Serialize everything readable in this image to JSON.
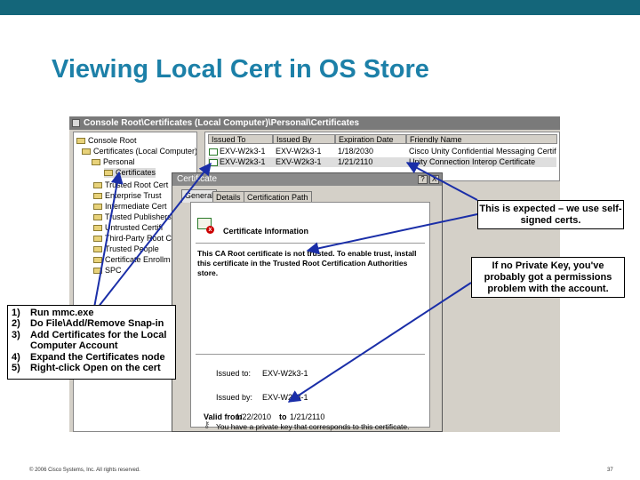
{
  "slide": {
    "title": "Viewing Local Cert in OS Store",
    "footer": "© 2006 Cisco Systems, Inc. All rights reserved.",
    "page_number": "37",
    "colors": {
      "topbar": "#14667a",
      "title": "#1c80a8"
    }
  },
  "mmc": {
    "window_title": "Console Root\\Certificates (Local Computer)\\Personal\\Certificates",
    "tree": [
      "Console Root",
      "Certificates (Local Computer)",
      "Personal",
      "Certificates",
      "Trusted Root Cert",
      "Enterprise Trust",
      "Intermediate Cert",
      "Trusted Publishers",
      "Untrusted Certifi",
      "Third-Party Root C",
      "Trusted People",
      "Certificate Enrollm",
      "SPC"
    ],
    "columns": [
      "Issued To",
      "Issued By",
      "Expiration Date",
      "Friendly Name"
    ],
    "rows": [
      {
        "issued_to": "EXV-W2k3-1",
        "issued_by": "EXV-W2k3-1",
        "expiration": "1/18/2030",
        "friendly_name": "Cisco Unity Confidential Messaging Certificate"
      },
      {
        "issued_to": "EXV-W2k3-1",
        "issued_by": "EXV-W2k3-1",
        "expiration": "1/21/2110",
        "friendly_name": "Unity Connection Interop Certificate"
      }
    ]
  },
  "dialog": {
    "title": "Certificate",
    "close_glyph": "X",
    "help_glyph": "?",
    "tabs": [
      "General",
      "Details",
      "Certification Path"
    ],
    "info_header": "Certificate Information",
    "warning": "This CA Root certificate is not trusted. To enable trust, install this certificate in the Trusted Root Certification Authorities store.",
    "issued_to_label": "Issued to:",
    "issued_to_value": "EXV-W2k3-1",
    "issued_by_label": "Issued by:",
    "issued_by_value": "EXV-W2k3-1",
    "valid_from_label": "Valid from",
    "valid_from": "1/22/2010",
    "to_label": "to",
    "valid_to": "1/21/2110",
    "private_key_note": "You have a private key that corresponds to this certificate."
  },
  "callouts": {
    "expected": "This is expected – we use self-signed certs.",
    "private_key": "If no Private Key, you've probably got a permissions problem with the account."
  },
  "steps": [
    {
      "num": "1)",
      "text": "Run mmc.exe"
    },
    {
      "num": "2)",
      "text": "Do File\\Add/Remove Snap-in"
    },
    {
      "num": "3)",
      "text": "Add Certificates for the Local Computer Account"
    },
    {
      "num": "4)",
      "text": "Expand the Certificates node"
    },
    {
      "num": "5)",
      "text": "Right-click Open on the cert"
    }
  ]
}
